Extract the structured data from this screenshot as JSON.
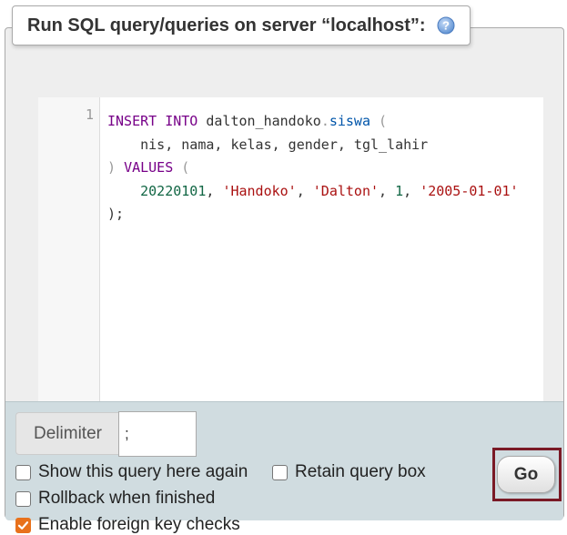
{
  "legend": {
    "title": "Run SQL query/queries on server “localhost”:",
    "help_icon": "help-question-icon"
  },
  "editor": {
    "line_number": "1",
    "lines": [
      [
        {
          "t": "INSERT INTO ",
          "c": "kw"
        },
        {
          "t": "dalton_handoko",
          "c": ""
        },
        {
          "t": ".",
          "c": "punct"
        },
        {
          "t": "siswa",
          "c": "tbl"
        },
        {
          "t": " (",
          "c": "punct"
        }
      ],
      [
        {
          "t": "    nis, nama, kelas, gender, tgl_lahir",
          "c": ""
        }
      ],
      [
        {
          "t": ") ",
          "c": "punct"
        },
        {
          "t": "VALUES",
          "c": "kw"
        },
        {
          "t": " (",
          "c": "punct"
        }
      ],
      [
        {
          "t": "    ",
          "c": ""
        },
        {
          "t": "20220101",
          "c": "num"
        },
        {
          "t": ", ",
          "c": ""
        },
        {
          "t": "'Handoko'",
          "c": "str"
        },
        {
          "t": ", ",
          "c": ""
        },
        {
          "t": "'Dalton'",
          "c": "str"
        },
        {
          "t": ", ",
          "c": ""
        },
        {
          "t": "1",
          "c": "num"
        },
        {
          "t": ", ",
          "c": ""
        },
        {
          "t": "'2005-01-01'",
          "c": "str"
        }
      ],
      [
        {
          "t": ");",
          "c": ""
        }
      ]
    ]
  },
  "delimiter": {
    "label": "Delimiter",
    "value": ";"
  },
  "options": {
    "show_query_again": {
      "label": "Show this query here again",
      "checked": false
    },
    "retain_query_box": {
      "label": "Retain query box",
      "checked": false
    },
    "rollback_when_finished": {
      "label": "Rollback when finished",
      "checked": false
    },
    "enable_foreign_key_checks": {
      "label": "Enable foreign key checks",
      "checked": true
    }
  },
  "go_button": {
    "label": "Go"
  },
  "colors": {
    "highlight_border": "#7a1a26",
    "checkbox_checked": "#e8711b"
  }
}
